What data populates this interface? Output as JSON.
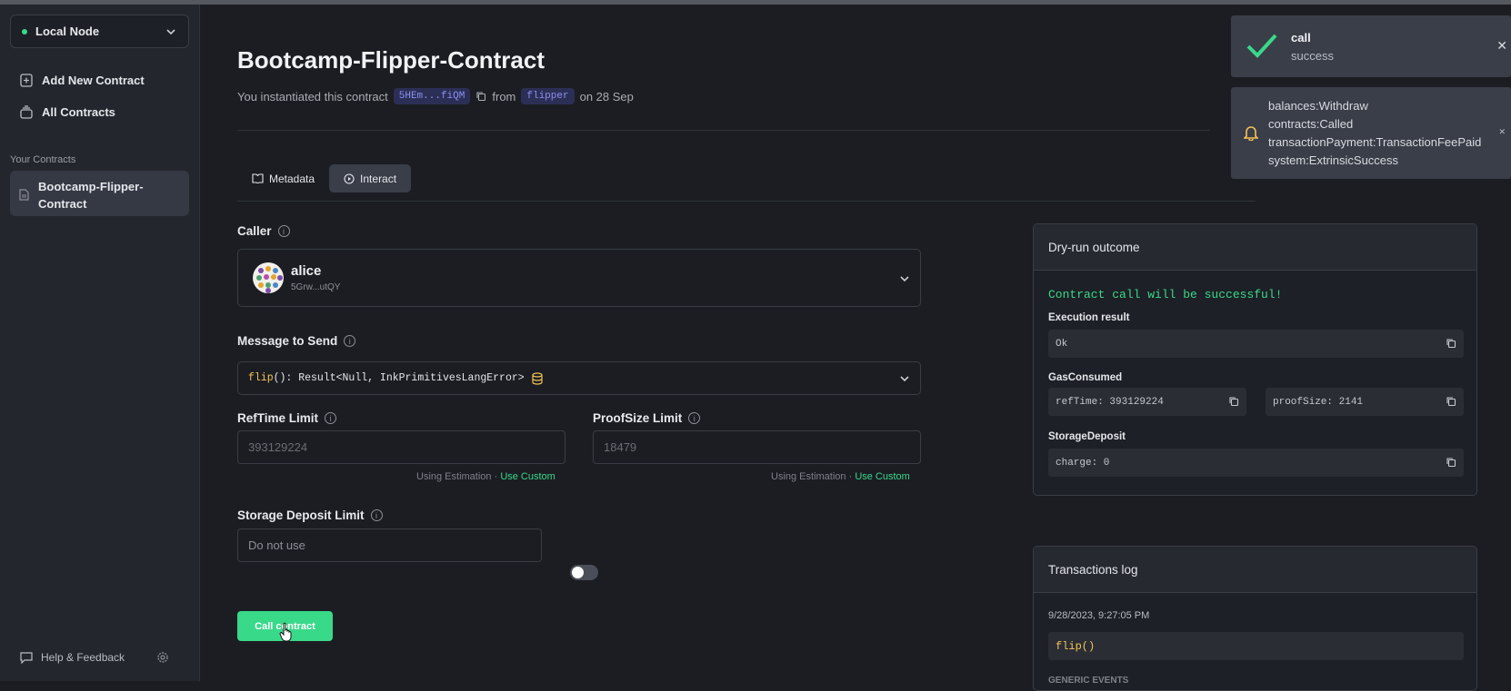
{
  "sidebar": {
    "node": "Local Node",
    "links": [
      "Add New Contract",
      "All Contracts"
    ],
    "section_label": "Your Contracts",
    "contract_item": "Bootcamp-Flipper-Contract",
    "footer": "Help & Feedback"
  },
  "header": {
    "title": "Bootcamp-Flipper-Contract",
    "sub_prefix": "You instantiated this contract",
    "address": "5HEm...fiQM",
    "from_word": "from",
    "code_name": "flipper",
    "date_text": "on 28 Sep"
  },
  "tabs": [
    {
      "label": "Metadata",
      "active": false
    },
    {
      "label": "Interact",
      "active": true
    }
  ],
  "form": {
    "caller_label": "Caller",
    "caller_name": "alice",
    "caller_address": "5Grw...utQY",
    "message_label": "Message to Send",
    "message_fn": "flip",
    "message_sig": "(): Result<Null, InkPrimitivesLangError>",
    "reftime_label": "RefTime Limit",
    "reftime_placeholder": "393129224",
    "proofsize_label": "ProofSize Limit",
    "proofsize_placeholder": "18479",
    "estimation_text": "Using Estimation · ",
    "use_custom": "Use Custom",
    "storage_label": "Storage Deposit Limit",
    "storage_placeholder": "Do not use",
    "storage_toggle_on": false,
    "call_button": "Call contract"
  },
  "dryrun": {
    "title": "Dry-run outcome",
    "success_msg": "Contract call will be successful!",
    "execution_label": "Execution result",
    "execution_value": "Ok",
    "gas_label": "GasConsumed",
    "reftime_value": "refTime: 393129224",
    "proofsize_value": "proofSize: 2141",
    "storage_label": "StorageDeposit",
    "storage_value": "charge: 0"
  },
  "txlog": {
    "title": "Transactions log",
    "timestamp": "9/28/2023, 9:27:05 PM",
    "call": "flip()",
    "events_label": "GENERIC EVENTS"
  },
  "toasts": {
    "t1_title": "call",
    "t1_sub": "success",
    "t2_lines": [
      "balances:Withdraw",
      "contracts:Called",
      "transactionPayment:TransactionFeePaid",
      "system:ExtrinsicSuccess"
    ]
  },
  "colors": {
    "accent_green": "#39d98a",
    "accent_yellow": "#f5c356",
    "chip_blue": "#8a90f2"
  }
}
